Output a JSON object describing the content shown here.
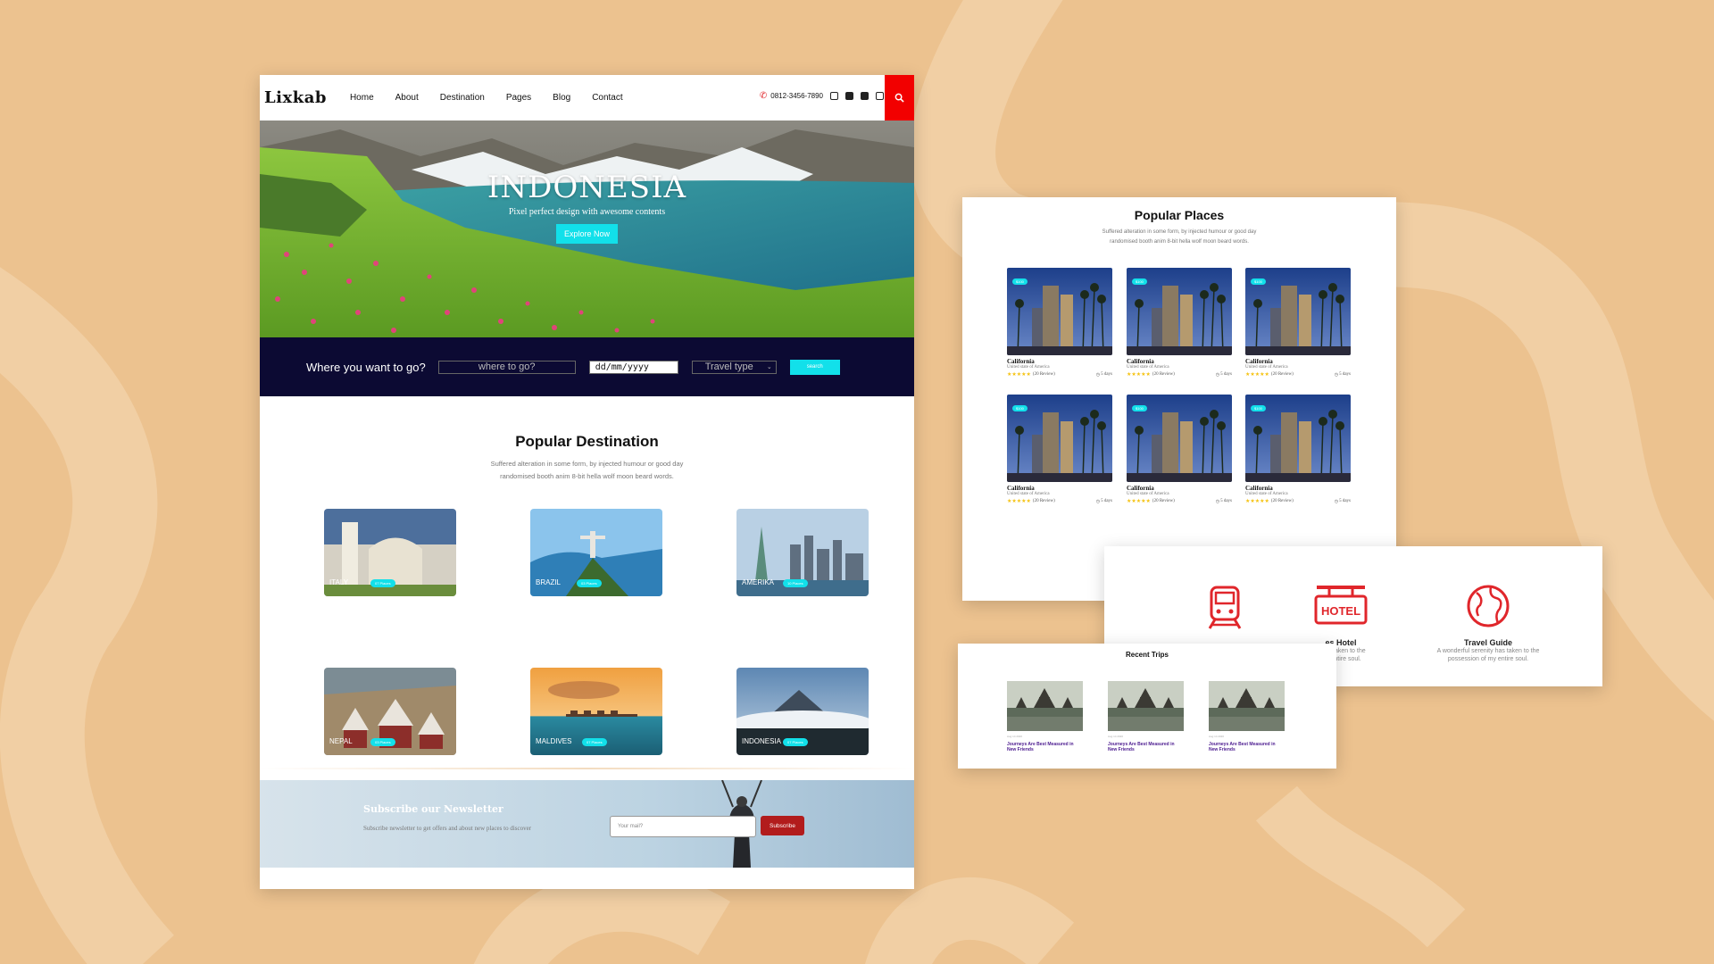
{
  "main": {
    "brand": "Lixkab",
    "nav": [
      "Home",
      "About",
      "Destination",
      "Pages",
      "Blog",
      "Contact"
    ],
    "phone": "0812-3456-7890",
    "hero": {
      "title": "INDONESIA",
      "subtitle": "Pixel perfect design with awesome contents",
      "button": "Explore Now"
    },
    "search": {
      "label": "Where you want to go?",
      "where_placeholder": "where to go?",
      "date_placeholder": "dd/mm/yyyy",
      "type_placeholder": "Travel type",
      "button": "search"
    },
    "popular_destination": {
      "title": "Popular Destination",
      "desc_line1": "Suffered alteration in some form, by injected humour or good day",
      "desc_line2": "randomised booth anim 8-bit hella wolf moon beard words.",
      "cards": [
        {
          "name": "ITALY",
          "badge": "07 Places"
        },
        {
          "name": "BRAZIL",
          "badge": "03 Places"
        },
        {
          "name": "AMERIKA",
          "badge": "10 Places"
        },
        {
          "name": "NEPAL",
          "badge": "03 Places"
        },
        {
          "name": "MALDIVES",
          "badge": "07 Places"
        },
        {
          "name": "INDONESIA",
          "badge": "07 Places"
        }
      ]
    },
    "newsletter": {
      "title": "Subscribe our Newsletter",
      "desc": "Subscribe newsletter to get offers and about new places to discover",
      "input_placeholder": "Your mail?",
      "button": "Subscribe"
    }
  },
  "popular_places": {
    "title": "Popular Places",
    "desc_line1": "Suffered alteration in some form, by injected humour or good day",
    "desc_line2": "randomised booth anim 8-bit hella wolf moon beard words.",
    "cards": [
      {
        "tag": "$100",
        "name": "California",
        "sub": "United state of America",
        "reviews": "(20 Review)",
        "days": "5 days"
      },
      {
        "tag": "$100",
        "name": "California",
        "sub": "United state of America",
        "reviews": "(20 Review)",
        "days": "5 days"
      },
      {
        "tag": "$100",
        "name": "California",
        "sub": "United state of America",
        "reviews": "(20 Review)",
        "days": "5 days"
      },
      {
        "tag": "$100",
        "name": "California",
        "sub": "United state of America",
        "reviews": "(20 Review)",
        "days": "5 days"
      },
      {
        "tag": "$100",
        "name": "California",
        "sub": "United state of America",
        "reviews": "(20 Review)",
        "days": "5 days"
      },
      {
        "tag": "$100",
        "name": "California",
        "sub": "United state of America",
        "reviews": "(20 Review)",
        "days": "5 days"
      }
    ]
  },
  "services": {
    "items": [
      {
        "title": "",
        "desc1": "",
        "desc2": ""
      },
      {
        "title": "es Hotel",
        "desc1": "y has taken to the",
        "desc2": "my entire soul."
      },
      {
        "title": "Travel Guide",
        "desc1": "A wonderful serenity has taken to the",
        "desc2": "possession of my entire soul."
      }
    ],
    "hotel_sign": "HOTEL"
  },
  "recent_trips": {
    "title": "Recent Trips",
    "cards": [
      {
        "date": "Aug 14 2020",
        "line1": "Journeys Are Best Measured in",
        "line2": "New Friends"
      },
      {
        "date": "Aug 14 2020",
        "line1": "Journeys Are Best Measured in",
        "line2": "New Friends"
      },
      {
        "date": "Aug 14 2020",
        "line1": "Journeys Are Best Measured in",
        "line2": "New Friends"
      }
    ]
  },
  "colors": {
    "background": "#ecc28f",
    "accent_cyan": "#12e0ea",
    "search_red": "#f20000",
    "navy": "#0c0a33",
    "subscribe_red": "#b21c1c"
  }
}
